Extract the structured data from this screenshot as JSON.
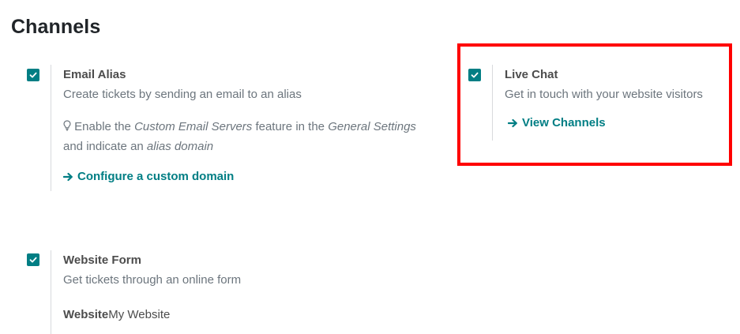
{
  "section": {
    "title": "Channels"
  },
  "email_alias": {
    "checked": true,
    "label": "Email Alias",
    "description": "Create tickets by sending an email to an alias",
    "hint": {
      "icon": "lightbulb-icon",
      "part1": "Enable the ",
      "em1": "Custom Email Servers",
      "part2": " feature in the ",
      "em2": "General Settings",
      "part3": "and indicate an ",
      "em3": "alias domain"
    },
    "link_label": "Configure a custom domain",
    "link_icon": "arrow-right-icon"
  },
  "live_chat": {
    "checked": true,
    "label": "Live Chat",
    "description": "Get in touch with your website visitors",
    "link_label": "View Channels",
    "link_icon": "arrow-right-icon"
  },
  "website_form": {
    "checked": true,
    "label": "Website Form",
    "description": "Get tickets through an online form",
    "website_label": "Website",
    "website_value": "My Website"
  },
  "colors": {
    "accent": "#017e84",
    "highlight": "#ff0000"
  }
}
